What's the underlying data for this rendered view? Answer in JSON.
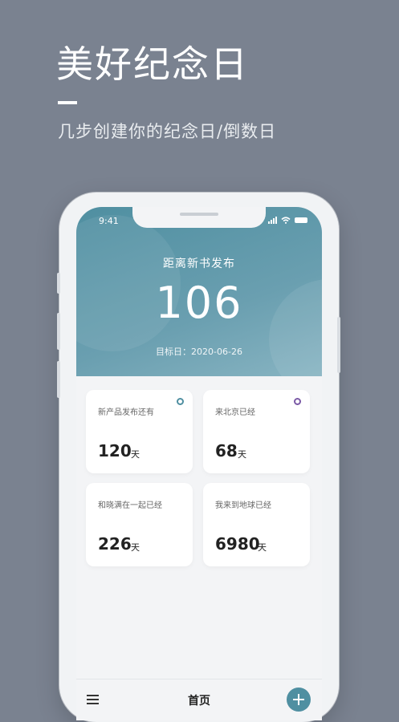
{
  "promo": {
    "title": "美好纪念日",
    "subtitle": "几步创建你的纪念日/倒数日"
  },
  "status_bar": {
    "time": "9:41"
  },
  "hero": {
    "label": "距离新书发布",
    "count": "106",
    "target_date": "目标日：2020-06-26"
  },
  "cards": [
    {
      "title": "新产品发布还有",
      "value": "120",
      "unit": "天",
      "dot_color": "#4f8fa1"
    },
    {
      "title": "来北京已经",
      "value": "68",
      "unit": "天",
      "dot_color": "#7b5aa6"
    },
    {
      "title": "和晓满在一起已经",
      "value": "226",
      "unit": "天"
    },
    {
      "title": "我来到地球已经",
      "value": "6980",
      "unit": "天"
    }
  ],
  "tabbar": {
    "title": "首页"
  },
  "colors": {
    "accent": "#4f8fa1",
    "background": "#7a8290"
  }
}
